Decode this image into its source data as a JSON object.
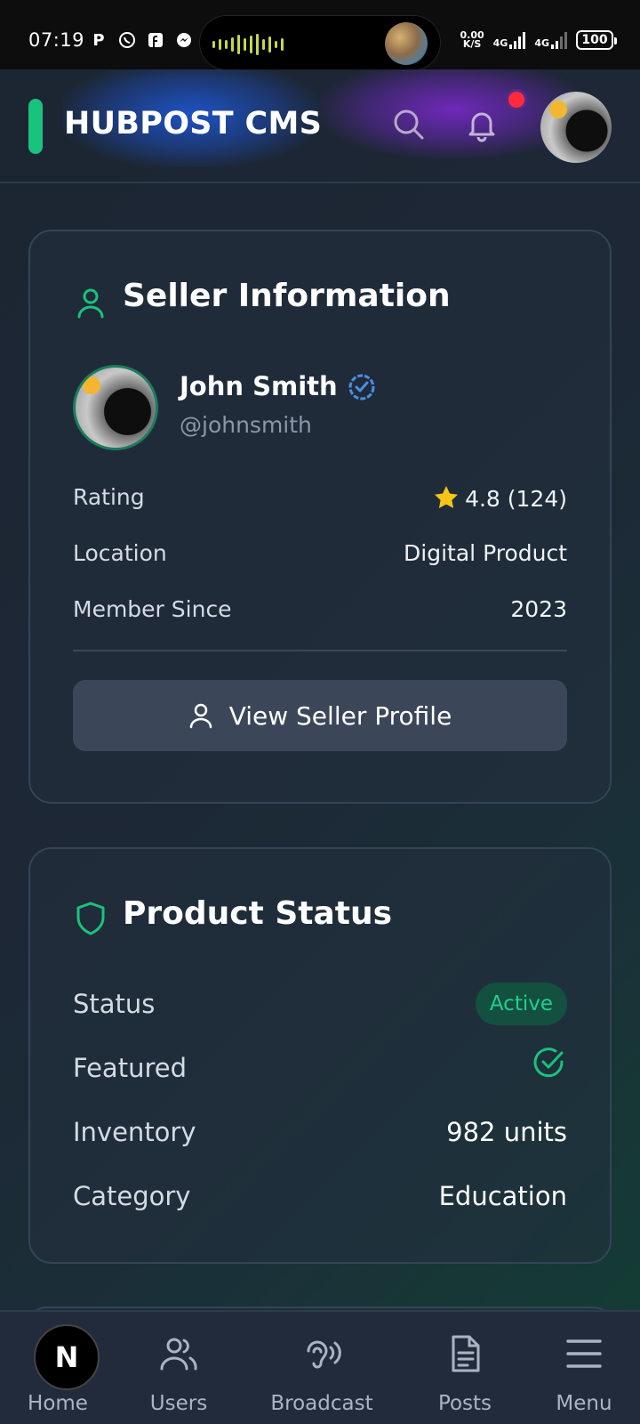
{
  "status_bar": {
    "time": "07:19",
    "net_speed_value": "0.00",
    "net_speed_unit": "K/S",
    "sim1": "4G",
    "sim2": "4G",
    "battery": "100"
  },
  "header": {
    "title": "HUBPOST CMS",
    "accent_color": "#19c37d",
    "notification_dot_color": "#ff2b3a"
  },
  "seller_card": {
    "title": "Seller Information",
    "name": "John Smith",
    "handle": "@johnsmith",
    "rows": [
      {
        "label": "Rating",
        "value": "4.8 (124)"
      },
      {
        "label": "Location",
        "value": "Digital Product"
      },
      {
        "label": "Member Since",
        "value": "2023"
      }
    ],
    "profile_button_label": "View Seller Profile"
  },
  "status_card": {
    "title": "Product Status",
    "status_label": "Status",
    "status_value": "Active",
    "featured_label": "Featured",
    "inventory_label": "Inventory",
    "inventory_value": "982 units",
    "category_label": "Category",
    "category_value": "Education"
  },
  "bottom_nav": {
    "items": [
      {
        "label": "Home",
        "icon": "home-icon"
      },
      {
        "label": "Users",
        "icon": "users-icon"
      },
      {
        "label": "Broadcast",
        "icon": "broadcast-icon"
      },
      {
        "label": "Posts",
        "icon": "document-icon"
      },
      {
        "label": "Menu",
        "icon": "hamburger-menu-icon"
      }
    ],
    "fab_letter": "N"
  }
}
